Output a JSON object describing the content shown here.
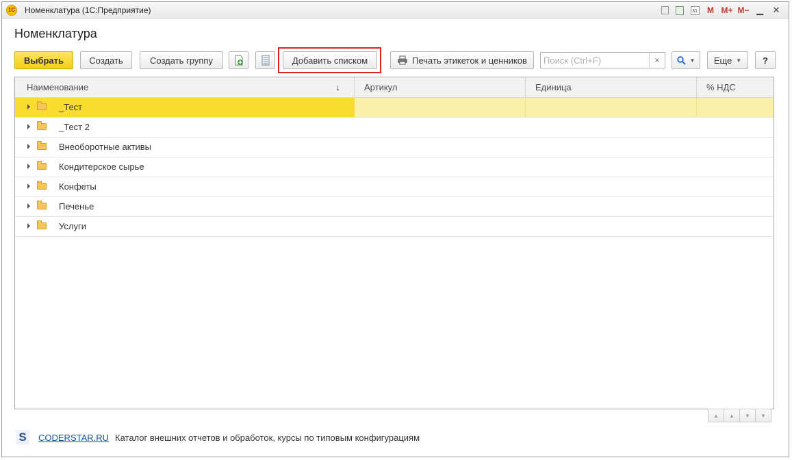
{
  "window": {
    "title": "Номенклатура  (1С:Предприятие)",
    "logo_text": "1С",
    "calendar_icon_text": "31",
    "memory_buttons": [
      "M",
      "M+",
      "M−"
    ],
    "minimize": "▁",
    "close": "✕"
  },
  "form": {
    "title": "Номенклатура"
  },
  "toolbar": {
    "select_label": "Выбрать",
    "create_label": "Создать",
    "create_group_label": "Создать группу",
    "add_list_label": "Добавить списком",
    "print_labels_label": "Печать этикеток и ценников",
    "search_placeholder": "Поиск (Ctrl+F)",
    "search_value": "",
    "clear_label": "×",
    "more_label": "Еще",
    "help_label": "?"
  },
  "grid": {
    "columns": [
      "Наименование",
      "Артикул",
      "Единица",
      "% НДС"
    ],
    "sort_indicator": "↓",
    "rows": [
      {
        "name": "_Тест",
        "article": "",
        "unit": "",
        "vat": "",
        "selected": true
      },
      {
        "name": "_Тест 2",
        "article": "",
        "unit": "",
        "vat": "",
        "selected": false
      },
      {
        "name": "Внеоборотные активы",
        "article": "",
        "unit": "",
        "vat": "",
        "selected": false
      },
      {
        "name": "Кондитерское сырье",
        "article": "",
        "unit": "",
        "vat": "",
        "selected": false
      },
      {
        "name": "Конфеты",
        "article": "",
        "unit": "",
        "vat": "",
        "selected": false
      },
      {
        "name": "Печенье",
        "article": "",
        "unit": "",
        "vat": "",
        "selected": false
      },
      {
        "name": "Услуги",
        "article": "",
        "unit": "",
        "vat": "",
        "selected": false
      }
    ]
  },
  "footer": {
    "logo_letter": "S",
    "link_text": "CODERSTAR.RU",
    "description": "Каталог внешних отчетов и обработок, курсы по типовым конфигурациям"
  },
  "colors": {
    "accent_yellow": "#f9dc2f",
    "selected_row_light": "#fbf0a7",
    "highlight_frame": "#d9251c",
    "link": "#1c4f9a"
  }
}
